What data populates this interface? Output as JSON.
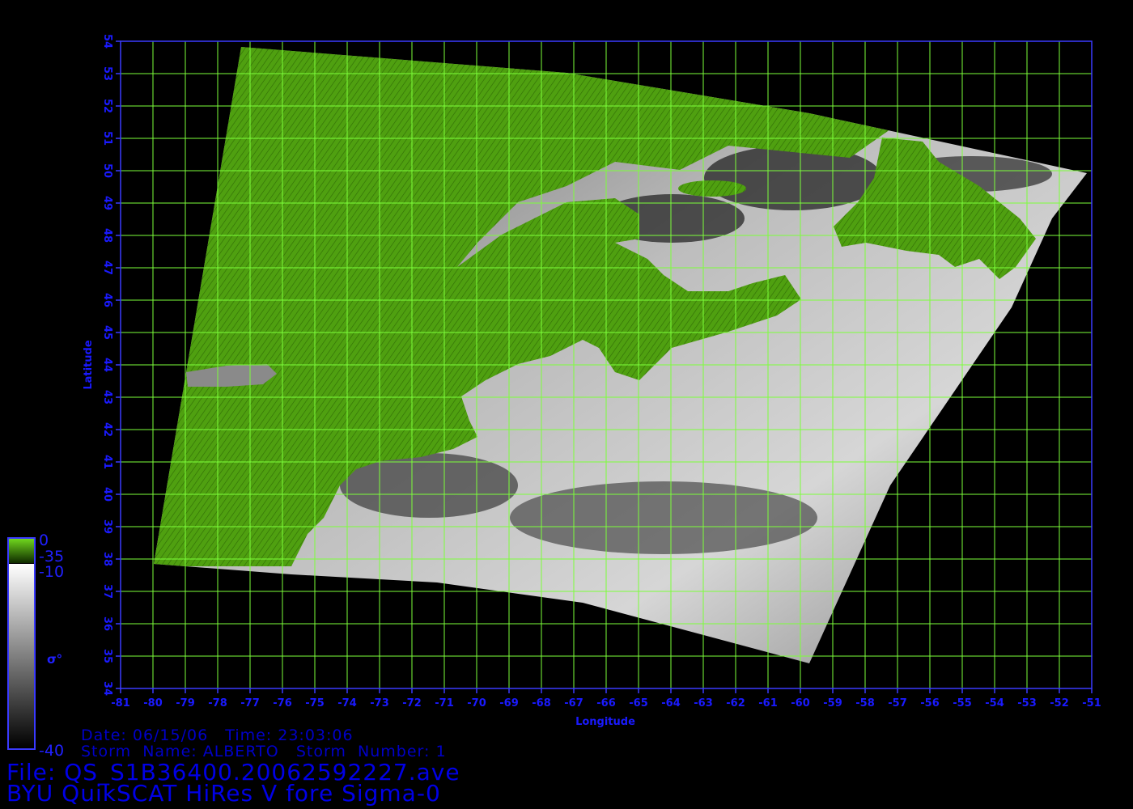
{
  "map": {
    "x_axis": {
      "label": "Longitude",
      "ticks": [
        "-81",
        "-80",
        "-79",
        "-78",
        "-77",
        "-76",
        "-75",
        "-74",
        "-73",
        "-72",
        "-71",
        "-70",
        "-69",
        "-68",
        "-67",
        "-66",
        "-65",
        "-64",
        "-63",
        "-62",
        "-61",
        "-60",
        "-59",
        "-58",
        "-57",
        "-56",
        "-55",
        "-54",
        "-53",
        "-52",
        "-51"
      ],
      "range": [
        -81,
        -51
      ]
    },
    "y_axis": {
      "label": "Latitude",
      "ticks": [
        "34",
        "35",
        "36",
        "37",
        "38",
        "39",
        "40",
        "41",
        "42",
        "43",
        "44",
        "45",
        "46",
        "47",
        "48",
        "49",
        "50",
        "51",
        "52",
        "53",
        "54"
      ],
      "range": [
        34,
        54
      ]
    },
    "grid": true,
    "colors": {
      "background": "#000000",
      "grid": "#7cff3a",
      "axis_text": "#1a1aff",
      "land": "#4fa010",
      "frame": "#3a3aff"
    }
  },
  "colorbar": {
    "land_scale": {
      "top": "0",
      "bottom": "-35"
    },
    "sea_scale": {
      "top": "-10",
      "bottom": "-40"
    },
    "label": "σ°"
  },
  "info": {
    "date_line": "Date: 06/15/06   Time: 23:03:06",
    "storm_line": "Storm  Name: ALBERTO   Storm  Number: 1",
    "file_line": "File: QS_S1B36400.20062592227.ave",
    "title_line": "BYU QuikSCAT HiRes V fore Sigma-0"
  }
}
